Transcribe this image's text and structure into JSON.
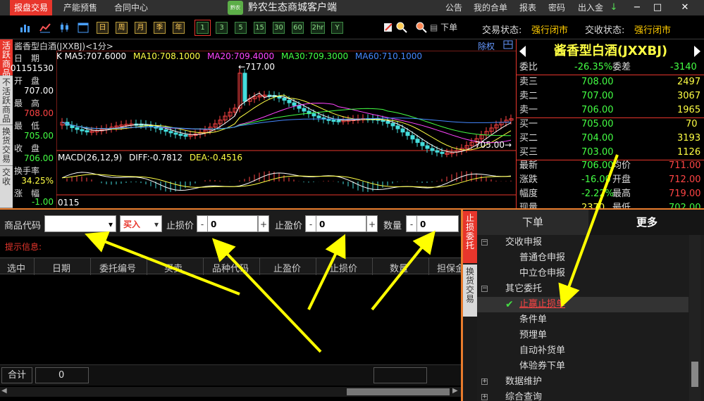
{
  "titlebar": {
    "menus": [
      "报盘交易",
      "产能预售",
      "合同中心"
    ],
    "logo_text": "黔农",
    "app_title": "黔农生态商城客户端",
    "right_menus": [
      "公告",
      "我的合单",
      "报表",
      "密码",
      "出入金"
    ],
    "window_buttons": [
      "↓",
      "−",
      "□",
      "✕"
    ]
  },
  "toolbar": {
    "period_buttons": [
      "日",
      "周",
      "月",
      "季",
      "年"
    ],
    "minute_buttons": [
      "1",
      "3",
      "5",
      "15",
      "30",
      "60",
      "2hr",
      "Y"
    ],
    "order_label": "下单",
    "trade_status_label": "交易状态:",
    "trade_status_value": "强行闭市",
    "delivery_status_label": "交收状态:",
    "delivery_status_value": "强行闭市"
  },
  "left_tabs": [
    "活跃商品",
    "不活跃商品",
    "换货交易",
    "交收"
  ],
  "chart": {
    "title": "酱香型白酒(JXXBJ)<1分>",
    "ma_line": [
      {
        "text": "K MA5:707.6000",
        "color": "#ffffff"
      },
      {
        "text": "MA10:708.1000",
        "color": "#ffff44"
      },
      {
        "text": "MA20:709.4000",
        "color": "#ff44ff"
      },
      {
        "text": "MA30:709.3000",
        "color": "#44ff44"
      },
      {
        "text": "MA60:710.1000",
        "color": "#4488ff"
      }
    ],
    "weight_label": "除权",
    "high_marker": "717.00",
    "low_marker": "705.00",
    "macd_line": [
      {
        "text": "MACD(26,12,9)",
        "color": "#ffffff"
      },
      {
        "text": "DIFF:-0.7812",
        "color": "#ffffff"
      },
      {
        "text": "DEA:-0.4516",
        "color": "#ffff44"
      }
    ],
    "info": {
      "date_label": "日　期",
      "date_value": "01151530",
      "open_label": "开　盘",
      "open_value": "707.00",
      "high_label": "最　高",
      "high_value": "708.00",
      "low_label": "最　低",
      "low_value": "705.00",
      "close_label": "收　盘",
      "close_value": "706.00",
      "turnover_label": "换手率",
      "turnover_value": "34.25%",
      "change_label": "涨　幅",
      "change_value": "-1.00",
      "volume_value": "0115"
    }
  },
  "chart_data": {
    "type": "candlestick",
    "high_marker": 717.0,
    "low_marker": 705.0
  },
  "quote": {
    "title": "酱香型白酒(JXXBJ)",
    "commission_ratio_label": "委比",
    "commission_ratio_value": "-26.35%",
    "commission_diff_label": "委差",
    "commission_diff_value": "-3140",
    "asks": [
      {
        "label": "卖三",
        "price": "708.00",
        "volume": "2497"
      },
      {
        "label": "卖二",
        "price": "707.00",
        "volume": "3067"
      },
      {
        "label": "卖一",
        "price": "706.00",
        "volume": "1965"
      }
    ],
    "bids": [
      {
        "label": "买一",
        "price": "705.00",
        "volume": "70"
      },
      {
        "label": "买二",
        "price": "704.00",
        "volume": "3193"
      },
      {
        "label": "买三",
        "price": "703.00",
        "volume": "1126"
      }
    ],
    "stats": [
      {
        "label": "最新",
        "value": "706.00",
        "label2": "均价",
        "value2": "711.00"
      },
      {
        "label": "涨跌",
        "value": "-16.00",
        "label2": "开盘",
        "value2": "712.00"
      },
      {
        "label": "幅度",
        "value": "-2.22%",
        "label2": "最高",
        "value2": "719.00"
      },
      {
        "label": "现量",
        "value": "2370",
        "label2": "最低",
        "value2": "702.00"
      }
    ]
  },
  "order_form": {
    "product_code_label": "商品代码",
    "product_code_value": "",
    "direction_value": "买入",
    "stop_loss_label": "止损价",
    "stop_loss_value": "0",
    "take_profit_label": "止盈价",
    "take_profit_value": "0",
    "quantity_label": "数量",
    "quantity_value": "0",
    "minus": "-",
    "plus": "+",
    "hint_label": "提示信息:"
  },
  "grid": {
    "columns": [
      "选中",
      "日期",
      "委托编号",
      "买卖",
      "品种代码",
      "止盈价",
      "止损价",
      "数量",
      "担保金"
    ],
    "total_label": "合计",
    "total_value": "0"
  },
  "right_tabs": [
    "止损委托",
    "换货交易"
  ],
  "menu": {
    "tabs": [
      "下单",
      "更多"
    ],
    "tree": [
      {
        "label": "交收申报",
        "level": 0,
        "toggle": "−"
      },
      {
        "label": "普通仓申报",
        "level": 1
      },
      {
        "label": "中立仓申报",
        "level": 1
      },
      {
        "label": "其它委托",
        "level": 0,
        "toggle": "−"
      },
      {
        "label": "止赢止损单",
        "level": 1,
        "selected": true,
        "check": "✔"
      },
      {
        "label": "条件单",
        "level": 1
      },
      {
        "label": "预埋单",
        "level": 1
      },
      {
        "label": "自动补货单",
        "level": 1
      },
      {
        "label": "体验券下单",
        "level": 1
      },
      {
        "label": "数据维护",
        "level": 0,
        "toggle": "+"
      },
      {
        "label": "综合查询",
        "level": 0,
        "toggle": "+"
      }
    ]
  },
  "colors": {
    "accent_red": "#e8362c",
    "orange_border": "#e87b2c",
    "price_up": "#ff4444",
    "price_down": "#44ff44",
    "gold": "#ffcc00"
  }
}
